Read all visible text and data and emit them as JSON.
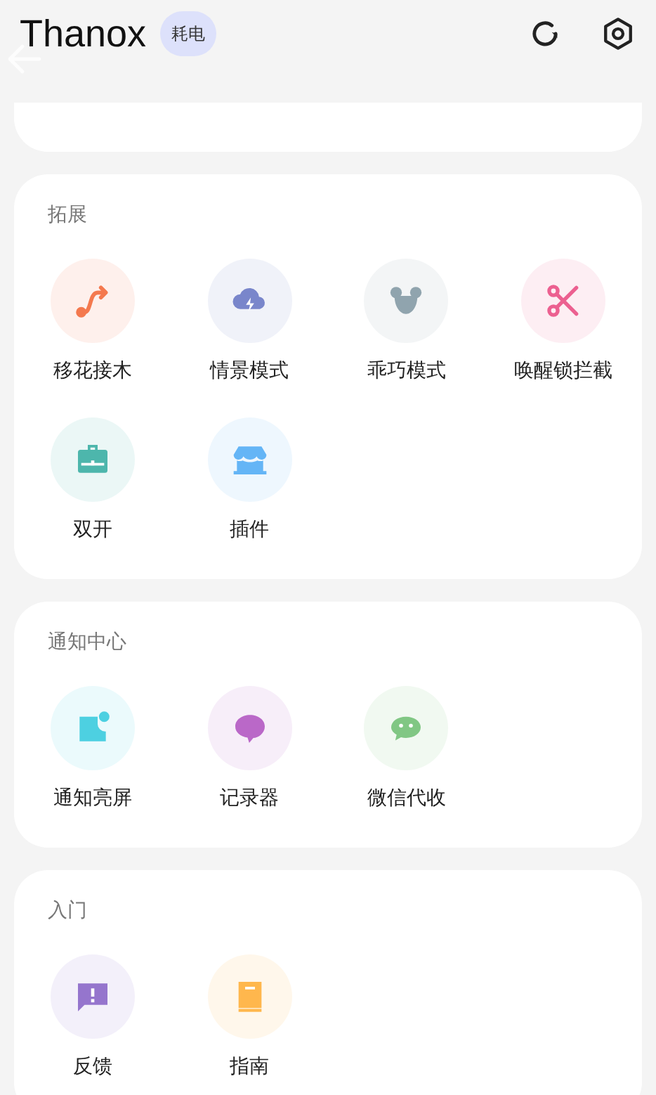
{
  "header": {
    "title": "Thanox",
    "badge": "耗电"
  },
  "sections": [
    {
      "title": "拓展",
      "items": [
        {
          "label": "移花接木",
          "kind": "route",
          "color": "#f4794e"
        },
        {
          "label": "情景模式",
          "kind": "cloud",
          "color": "#7986cb"
        },
        {
          "label": "乖巧模式",
          "kind": "bear",
          "color": "#90a4ae"
        },
        {
          "label": "唤醒锁拦截",
          "kind": "scissors",
          "color": "#ec6090"
        },
        {
          "label": "双开",
          "kind": "briefcase",
          "color": "#4db6ac"
        },
        {
          "label": "插件",
          "kind": "store",
          "color": "#64b5f6"
        }
      ]
    },
    {
      "title": "通知中心",
      "items": [
        {
          "label": "通知亮屏",
          "kind": "notify",
          "color": "#4dd0e1"
        },
        {
          "label": "记录器",
          "kind": "bubble",
          "color": "#ba68c8"
        },
        {
          "label": "微信代收",
          "kind": "chat",
          "color": "#81c784"
        }
      ]
    },
    {
      "title": "入门",
      "items": [
        {
          "label": "反馈",
          "kind": "feedback",
          "color": "#9575cd"
        },
        {
          "label": "指南",
          "kind": "book",
          "color": "#ffb74d"
        }
      ]
    }
  ]
}
